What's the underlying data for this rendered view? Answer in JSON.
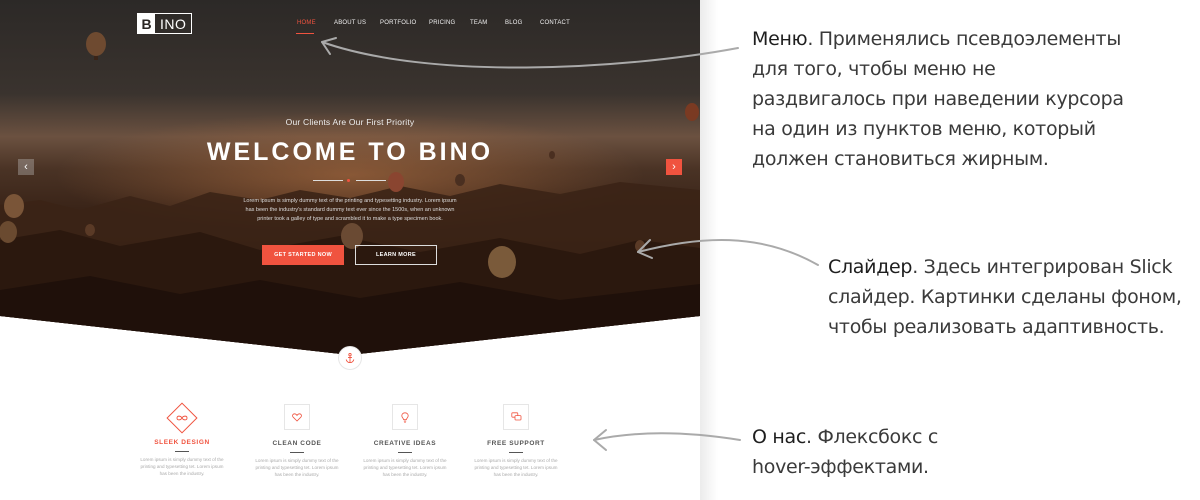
{
  "site": {
    "logo": {
      "letter": "B",
      "rest": "INO"
    },
    "nav": [
      {
        "label": "HOME",
        "active": true
      },
      {
        "label": "ABOUT US",
        "active": false
      },
      {
        "label": "PORTFOLIO",
        "active": false
      },
      {
        "label": "PRICING",
        "active": false
      },
      {
        "label": "TEAM",
        "active": false
      },
      {
        "label": "BLOG",
        "active": false
      },
      {
        "label": "CONTACT",
        "active": false
      }
    ],
    "hero": {
      "subtitle": "Our Clients Are Our First Priority",
      "title": "WELCOME TO BINO",
      "description": "Lorem ipsum is simply dummy text of the printing and typesetting industry. Lorem ipsum has been the industry's standard dummy text ever since the 1500s, when an unknown printer took a galley of type and scrambled it to make a type specimen book.",
      "primary_button": "GET STARTED NOW",
      "secondary_button": "LEARN MORE",
      "prev_arrow": "‹",
      "next_arrow": "›"
    },
    "features": [
      {
        "name": "SLEEK DESIGN",
        "icon": "infinity-icon",
        "highlighted": true,
        "text": "Lorem ipsum is simply dummy text of the printing and typesetting tet. Lorem ipsum has been the industry."
      },
      {
        "name": "CLEAN CODE",
        "icon": "heart-icon",
        "highlighted": false,
        "text": "Lorem ipsum is simply dummy text of the printing and typesetting tet. Lorem ipsum has been the industry."
      },
      {
        "name": "CREATIVE IDEAS",
        "icon": "lightbulb-icon",
        "highlighted": false,
        "text": "Lorem ipsum is simply dummy text of the printing and typesetting tet. Lorem ipsum has been the industry."
      },
      {
        "name": "FREE SUPPORT",
        "icon": "chat-icon",
        "highlighted": false,
        "text": "Lorem ipsum is simply dummy text of the printing and typesetting tet. Lorem ipsum has been the industry."
      }
    ],
    "colors": {
      "accent": "#f0533f",
      "dark": "#2a2623"
    }
  },
  "notes": {
    "menu": {
      "head": "Меню",
      "lines": [
        ". Применялись псевдоэлементы",
        "для того, чтобы меню не",
        "раздвигалось при наведении курсора",
        "на один из пунктов меню, который",
        "должен становиться жирным."
      ]
    },
    "slider": {
      "head": "Слайдер",
      "lines": [
        ". Здесь интегрирован Slick",
        "слайдер. Картинки сделаны фоном,",
        "чтобы реализовать адаптивность."
      ]
    },
    "about": {
      "head": "О нас",
      "lines": [
        ". Флексбокс с",
        "hover-эффектами."
      ]
    }
  }
}
